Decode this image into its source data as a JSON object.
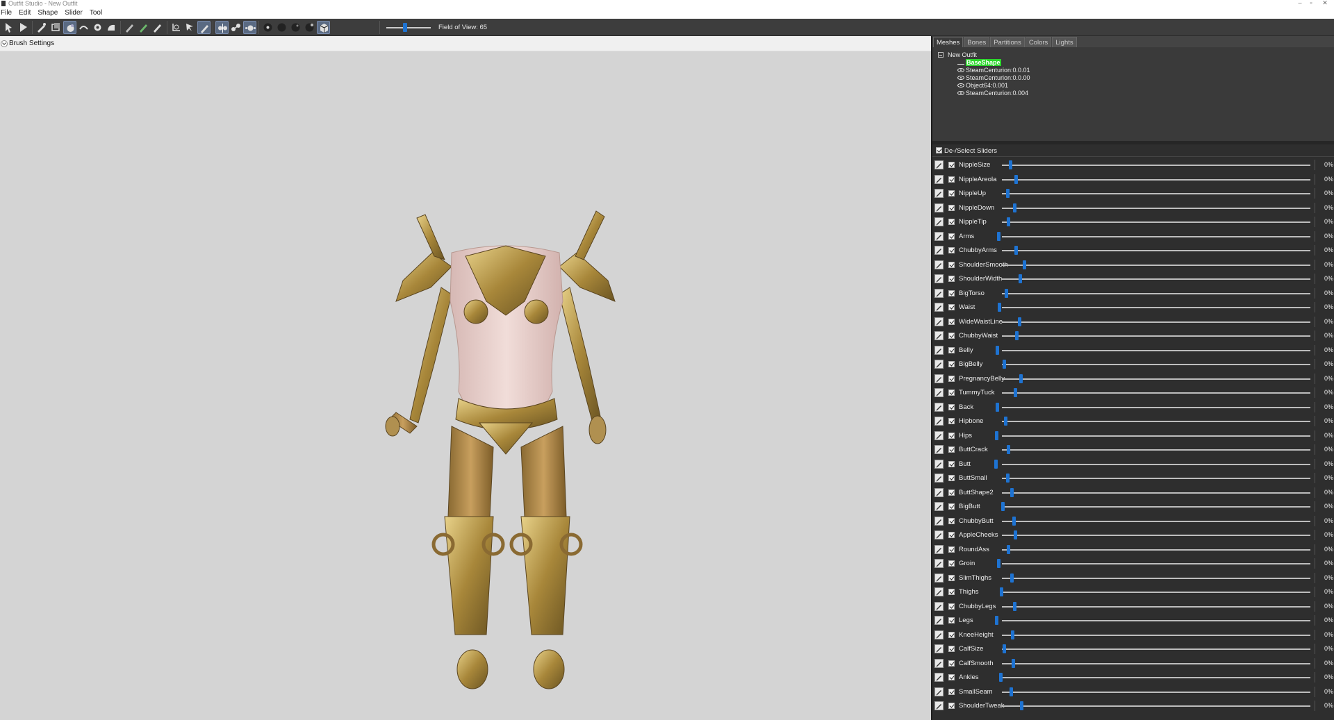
{
  "window": {
    "title": "Outfit Studio - New Outfit"
  },
  "menu": [
    "File",
    "Edit",
    "Shape",
    "Slider",
    "Tool"
  ],
  "toolbar": {
    "icons": [
      "select-tool-icon",
      "transform-tool-icon",
      "mask-brush-icon",
      "inflate-brush-icon",
      "deflate-brush-icon",
      "move-brush-icon",
      "smooth-brush-icon",
      "undiff-brush-icon",
      "weight-brush-icon",
      "color-brush-icon",
      "alpha-brush-icon",
      "pivot-icon",
      "vertex-edit-icon",
      "edge-collapse-icon",
      "xmirror-icon",
      "connected-only-icon",
      "global-brush-icon",
      "wireframe-icon",
      "lighting-icon",
      "texture-icon",
      "vertex-colors-icon",
      "bones-icon"
    ],
    "fov_label": "Field of View: 65",
    "fov_value": 65
  },
  "brush_settings": {
    "label": "Brush Settings"
  },
  "right_panel": {
    "tabs": [
      "Meshes",
      "Bones",
      "Partitions",
      "Colors",
      "Lights"
    ],
    "active_tab": "Meshes",
    "tree": {
      "root": "New Outfit",
      "items": [
        "BaseShape",
        "SteamCenturion:0.0.01",
        "SteamCenturion:0.0.00",
        "Object64:0.001",
        "SteamCenturion:0.004"
      ]
    },
    "sliders_header": "De-/Select Sliders",
    "sliders": [
      {
        "name": "NippleSize",
        "value": "0%"
      },
      {
        "name": "NippleAreola",
        "value": "0%"
      },
      {
        "name": "NippleUp",
        "value": "0%"
      },
      {
        "name": "NippleDown",
        "value": "0%"
      },
      {
        "name": "NippleTip",
        "value": "0%"
      },
      {
        "name": "Arms",
        "value": "0%"
      },
      {
        "name": "ChubbyArms",
        "value": "0%"
      },
      {
        "name": "ShoulderSmooth",
        "value": "0%"
      },
      {
        "name": "ShoulderWidth",
        "value": "0%"
      },
      {
        "name": "BigTorso",
        "value": "0%"
      },
      {
        "name": "Waist",
        "value": "0%"
      },
      {
        "name": "WideWaistLine",
        "value": "0%"
      },
      {
        "name": "ChubbyWaist",
        "value": "0%"
      },
      {
        "name": "Belly",
        "value": "0%"
      },
      {
        "name": "BigBelly",
        "value": "0%"
      },
      {
        "name": "PregnancyBelly",
        "value": "0%"
      },
      {
        "name": "TummyTuck",
        "value": "0%"
      },
      {
        "name": "Back",
        "value": "0%"
      },
      {
        "name": "Hipbone",
        "value": "0%"
      },
      {
        "name": "Hips",
        "value": "0%"
      },
      {
        "name": "ButtCrack",
        "value": "0%"
      },
      {
        "name": "Butt",
        "value": "0%"
      },
      {
        "name": "ButtSmall",
        "value": "0%"
      },
      {
        "name": "ButtShape2",
        "value": "0%"
      },
      {
        "name": "BigButt",
        "value": "0%"
      },
      {
        "name": "ChubbyButt",
        "value": "0%"
      },
      {
        "name": "AppleCheeks",
        "value": "0%"
      },
      {
        "name": "RoundAss",
        "value": "0%"
      },
      {
        "name": "Groin",
        "value": "0%"
      },
      {
        "name": "SlimThighs",
        "value": "0%"
      },
      {
        "name": "Thighs",
        "value": "0%"
      },
      {
        "name": "ChubbyLegs",
        "value": "0%"
      },
      {
        "name": "Legs",
        "value": "0%"
      },
      {
        "name": "KneeHeight",
        "value": "0%"
      },
      {
        "name": "CalfSize",
        "value": "0%"
      },
      {
        "name": "CalfSmooth",
        "value": "0%"
      },
      {
        "name": "Ankles",
        "value": "0%"
      },
      {
        "name": "SmallSeam",
        "value": "0%"
      },
      {
        "name": "ShoulderTweak",
        "value": "0%"
      }
    ]
  },
  "colors": {
    "accent": "#1e73d2",
    "highlight": "#2bd62b",
    "panel": "#2e2e2e",
    "toolbar": "#3d3d3d",
    "viewport": "#d4d4d4"
  }
}
